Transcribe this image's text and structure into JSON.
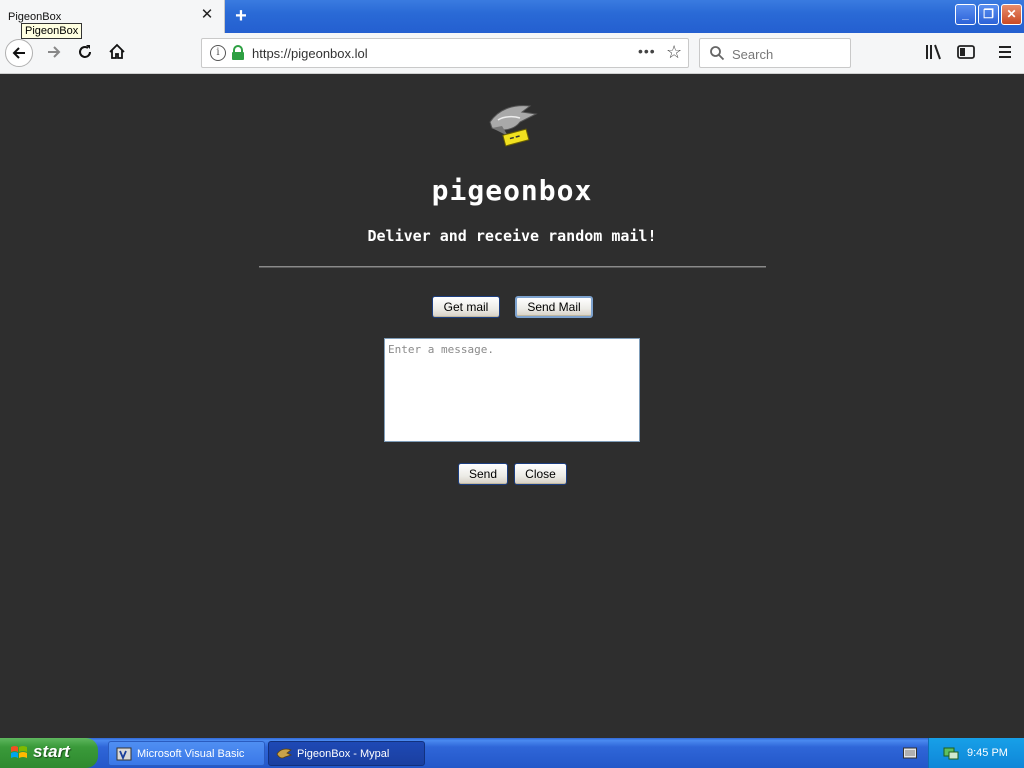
{
  "browser": {
    "tab_title": "PigeonBox",
    "tooltip": "PigeonBox",
    "url": "https://pigeonbox.lol",
    "search_placeholder": "Search"
  },
  "page": {
    "brand": "pigeonbox",
    "tagline": "Deliver and receive random mail!",
    "get_mail_label": "Get mail",
    "send_mail_label": "Send Mail",
    "message_placeholder": "Enter a message.",
    "send_label": "Send",
    "close_label": "Close"
  },
  "taskbar": {
    "start_label": "start",
    "tasks": [
      {
        "label": "Microsoft Visual Basic",
        "icon": "visual-basic-icon",
        "active": false
      },
      {
        "label": "PigeonBox - Mypal",
        "icon": "mypal-browser-icon",
        "active": true
      }
    ],
    "clock": "9:45 PM"
  },
  "colors": {
    "page_background": "#2e2e2e",
    "taskbar_blue": "#2357c9",
    "start_green": "#3a9a3a",
    "lock_green": "#2ea043"
  }
}
